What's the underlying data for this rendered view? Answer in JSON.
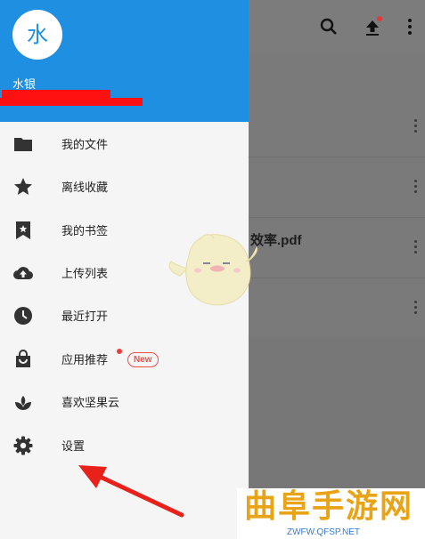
{
  "colors": {
    "header": "#1e8fe1",
    "drawer_bg": "#f5f5f5",
    "icon": "#333333",
    "badge": "#f0504d",
    "scrim": "#7a7a7a"
  },
  "toolbar": {
    "icons": [
      "search-icon",
      "upload-icon",
      "more-vert-icon"
    ]
  },
  "background": {
    "file_name": "效率.pdf"
  },
  "drawer": {
    "avatar_letter": "水",
    "username": "水银",
    "menu": [
      {
        "label": "我的文件",
        "icon": "folder-icon"
      },
      {
        "label": "离线收藏",
        "icon": "star-icon"
      },
      {
        "label": "我的书签",
        "icon": "bookmark-icon"
      },
      {
        "label": "上传列表",
        "icon": "cloud-upload-icon"
      },
      {
        "label": "最近打开",
        "icon": "clock-icon"
      },
      {
        "label": "应用推荐",
        "icon": "shopping-bag-icon",
        "badge": "New"
      },
      {
        "label": "喜欢坚果云",
        "icon": "sprout-icon"
      },
      {
        "label": "设置",
        "icon": "gear-icon"
      }
    ]
  },
  "watermark": {
    "title": "曲阜手游网",
    "url": "ZWFW.QFSP.NET"
  }
}
